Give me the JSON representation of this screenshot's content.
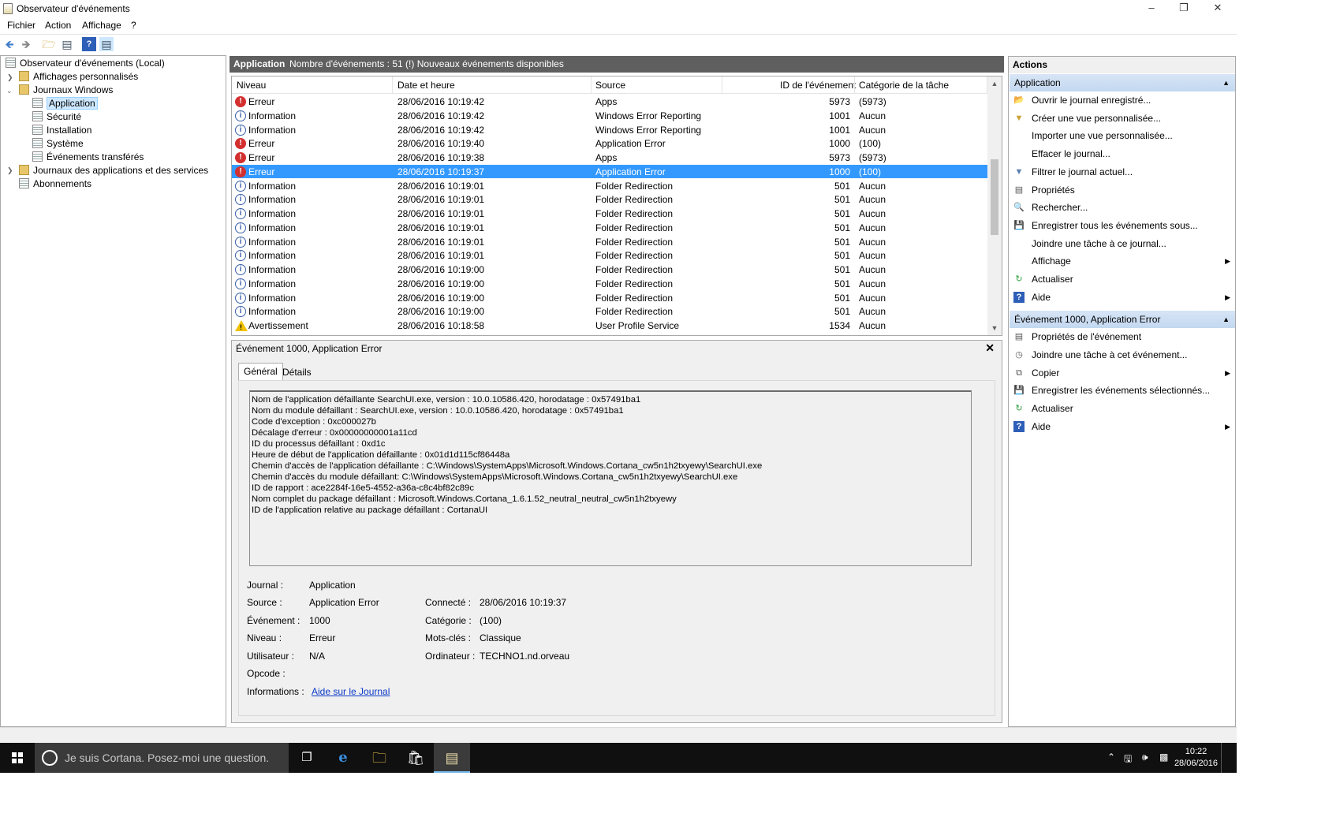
{
  "window": {
    "title": "Observateur d'événements"
  },
  "menu": [
    "Fichier",
    "Action",
    "Affichage",
    "?"
  ],
  "tree": {
    "root": "Observateur d'événements (Local)",
    "custom_views": "Affichages personnalisés",
    "windows_logs": "Journaux Windows",
    "application": "Application",
    "security": "Sécurité",
    "setup": "Installation",
    "system": "Système",
    "forwarded": "Événements transférés",
    "app_services": "Journaux des applications et des services",
    "subscriptions": "Abonnements"
  },
  "header": {
    "name": "Application",
    "count": "Nombre d'événements : 51 (!) Nouveaux événements disponibles"
  },
  "columns": {
    "level": "Niveau",
    "date": "Date et heure",
    "source": "Source",
    "event_id": "ID de l'événement",
    "category": "Catégorie de la tâche"
  },
  "events": [
    {
      "level": "Erreur",
      "type": "err",
      "date": "28/06/2016 10:19:42",
      "source": "Apps",
      "id": "5973",
      "cat": "(5973)"
    },
    {
      "level": "Information",
      "type": "info",
      "date": "28/06/2016 10:19:42",
      "source": "Windows Error Reporting",
      "id": "1001",
      "cat": "Aucun"
    },
    {
      "level": "Information",
      "type": "info",
      "date": "28/06/2016 10:19:42",
      "source": "Windows Error Reporting",
      "id": "1001",
      "cat": "Aucun"
    },
    {
      "level": "Erreur",
      "type": "err",
      "date": "28/06/2016 10:19:40",
      "source": "Application Error",
      "id": "1000",
      "cat": "(100)"
    },
    {
      "level": "Erreur",
      "type": "err",
      "date": "28/06/2016 10:19:38",
      "source": "Apps",
      "id": "5973",
      "cat": "(5973)"
    },
    {
      "level": "Erreur",
      "type": "err",
      "date": "28/06/2016 10:19:37",
      "source": "Application Error",
      "id": "1000",
      "cat": "(100)",
      "selected": true
    },
    {
      "level": "Information",
      "type": "info",
      "date": "28/06/2016 10:19:01",
      "source": "Folder Redirection",
      "id": "501",
      "cat": "Aucun"
    },
    {
      "level": "Information",
      "type": "info",
      "date": "28/06/2016 10:19:01",
      "source": "Folder Redirection",
      "id": "501",
      "cat": "Aucun"
    },
    {
      "level": "Information",
      "type": "info",
      "date": "28/06/2016 10:19:01",
      "source": "Folder Redirection",
      "id": "501",
      "cat": "Aucun"
    },
    {
      "level": "Information",
      "type": "info",
      "date": "28/06/2016 10:19:01",
      "source": "Folder Redirection",
      "id": "501",
      "cat": "Aucun"
    },
    {
      "level": "Information",
      "type": "info",
      "date": "28/06/2016 10:19:01",
      "source": "Folder Redirection",
      "id": "501",
      "cat": "Aucun"
    },
    {
      "level": "Information",
      "type": "info",
      "date": "28/06/2016 10:19:01",
      "source": "Folder Redirection",
      "id": "501",
      "cat": "Aucun"
    },
    {
      "level": "Information",
      "type": "info",
      "date": "28/06/2016 10:19:00",
      "source": "Folder Redirection",
      "id": "501",
      "cat": "Aucun"
    },
    {
      "level": "Information",
      "type": "info",
      "date": "28/06/2016 10:19:00",
      "source": "Folder Redirection",
      "id": "501",
      "cat": "Aucun"
    },
    {
      "level": "Information",
      "type": "info",
      "date": "28/06/2016 10:19:00",
      "source": "Folder Redirection",
      "id": "501",
      "cat": "Aucun"
    },
    {
      "level": "Information",
      "type": "info",
      "date": "28/06/2016 10:19:00",
      "source": "Folder Redirection",
      "id": "501",
      "cat": "Aucun"
    },
    {
      "level": "Avertissement",
      "type": "warn",
      "date": "28/06/2016 10:18:58",
      "source": "User Profile Service",
      "id": "1534",
      "cat": "Aucun"
    }
  ],
  "detail": {
    "title": "Événement 1000, Application Error",
    "tab_general": "Général",
    "tab_details": "Détails",
    "message": [
      "Nom de l'application défaillante SearchUI.exe, version : 10.0.10586.420, horodatage : 0x57491ba1",
      "Nom du module défaillant : SearchUI.exe, version : 10.0.10586.420, horodatage : 0x57491ba1",
      "Code d'exception : 0xc000027b",
      "Décalage d'erreur : 0x00000000001a11cd",
      "ID du processus défaillant : 0xd1c",
      "Heure de début de l'application défaillante : 0x01d1d115cf86448a",
      "Chemin d'accès de l'application défaillante : C:\\Windows\\SystemApps\\Microsoft.Windows.Cortana_cw5n1h2txyewy\\SearchUI.exe",
      "Chemin d'accès du module défaillant: C:\\Windows\\SystemApps\\Microsoft.Windows.Cortana_cw5n1h2txyewy\\SearchUI.exe",
      "ID de rapport : ace2284f-16e5-4552-a36a-c8c4bf82c89c",
      "Nom complet du package défaillant : Microsoft.Windows.Cortana_1.6.1.52_neutral_neutral_cw5n1h2txyewy",
      "ID de l'application relative au package défaillant : CortanaUI"
    ],
    "labels": {
      "journal": "Journal :",
      "source": "Source :",
      "event": "Événement :",
      "level": "Niveau :",
      "user": "Utilisateur :",
      "opcode": "Opcode :",
      "info": "Informations :",
      "logged": "Connecté :",
      "category": "Catégorie :",
      "keywords": "Mots-clés :",
      "computer": "Ordinateur :"
    },
    "values": {
      "journal": "Application",
      "source": "Application Error",
      "event": "1000",
      "level": "Erreur",
      "user": "N/A",
      "opcode": "",
      "info_link": "Aide sur le Journal",
      "logged": "28/06/2016 10:19:37",
      "category": "(100)",
      "keywords": "Classique",
      "computer": "TECHNO1.nd.orveau"
    }
  },
  "actions": {
    "title": "Actions",
    "section1": "Application",
    "items1": [
      "Ouvrir le journal enregistré...",
      "Créer une vue personnalisée...",
      "Importer une vue personnalisée...",
      "Effacer le journal...",
      "Filtrer le journal actuel...",
      "Propriétés",
      "Rechercher...",
      "Enregistrer tous les événements sous...",
      "Joindre une tâche à ce journal...",
      "Affichage",
      "Actualiser",
      "Aide"
    ],
    "section2": "Événement 1000, Application Error",
    "items2": [
      "Propriétés de l'événement",
      "Joindre une tâche à cet événement...",
      "Copier",
      "Enregistrer les événements sélectionnés...",
      "Actualiser",
      "Aide"
    ]
  },
  "taskbar": {
    "search": "Je suis Cortana. Posez-moi une question.",
    "time": "10:22",
    "date": "28/06/2016"
  }
}
